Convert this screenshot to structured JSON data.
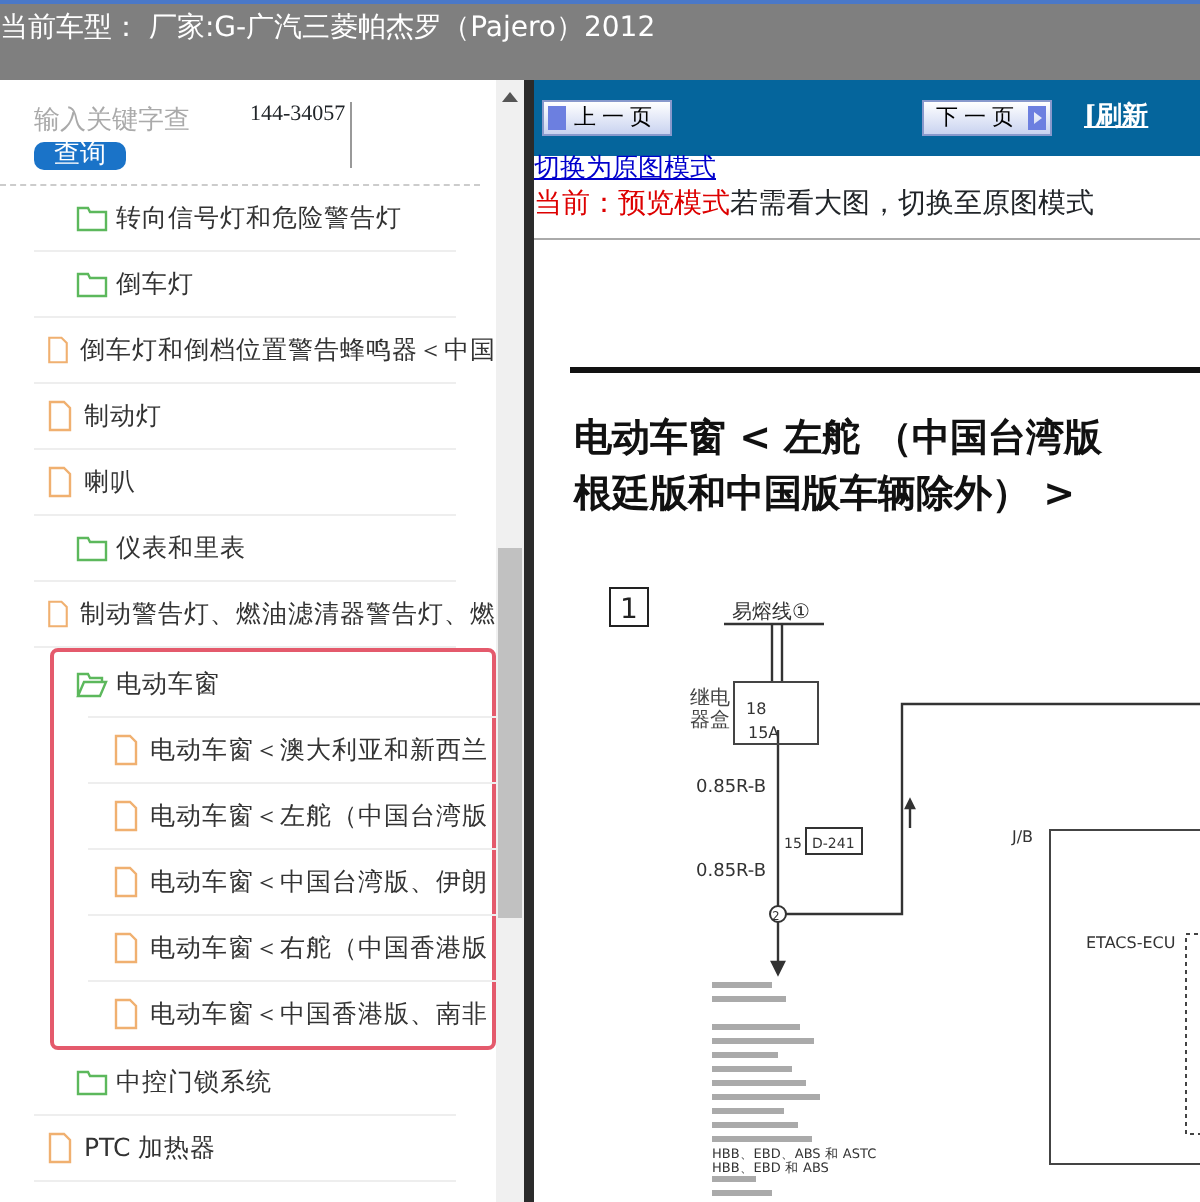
{
  "header": {
    "title": "当前车型：  厂家:G-广汽三菱帕杰罗（Pajero）2012"
  },
  "search": {
    "placeholder": "输入关键字查",
    "button": "查询",
    "code": "144-34057"
  },
  "tree": [
    {
      "kind": "folder",
      "label": "转向信号灯和危险警告灯",
      "expanded": false,
      "selected": false
    },
    {
      "kind": "folder",
      "label": "倒车灯",
      "expanded": false,
      "selected": false
    },
    {
      "kind": "file",
      "label": "倒车灯和倒档位置警告蜂鸣器＜中国",
      "selected": false
    },
    {
      "kind": "file",
      "label": "制动灯",
      "selected": false
    },
    {
      "kind": "file",
      "label": "喇叭",
      "selected": false
    },
    {
      "kind": "folder",
      "label": "仪表和里表",
      "expanded": false,
      "selected": false
    },
    {
      "kind": "file",
      "label": "制动警告灯、燃油滤清器警告灯、燃",
      "selected": false
    },
    {
      "kind": "folder",
      "label": "电动车窗",
      "expanded": true,
      "selected": true,
      "children": [
        {
          "kind": "file",
          "label": "电动车窗＜澳大利亚和新西兰"
        },
        {
          "kind": "file",
          "label": "电动车窗＜左舵（中国台湾版"
        },
        {
          "kind": "file",
          "label": "电动车窗＜中国台湾版、伊朗"
        },
        {
          "kind": "file",
          "label": "电动车窗＜右舵（中国香港版"
        },
        {
          "kind": "file",
          "label": "电动车窗＜中国香港版、南非"
        }
      ]
    },
    {
      "kind": "folder",
      "label": "中控门锁系统",
      "expanded": false,
      "selected": false
    },
    {
      "kind": "file",
      "label": "PTC 加热器",
      "selected": false
    }
  ],
  "viewer": {
    "prev_button": "上一页",
    "next_button": "下一页",
    "refresh_link": "[刷新",
    "mode_link": "切换为原图模式",
    "mode_status": "当前：预览模式",
    "mode_hint": "若需看大图，切换至原图模式",
    "document": {
      "title_lines": [
        "电动车窗 < 左舵 （中国台湾版",
        "根廷版和中国版车辆除外） >"
      ],
      "section": "1",
      "fusible_link": "易熔线①",
      "relay_box": [
        "继电",
        "器盒"
      ],
      "fuse_number": "18",
      "fuse_rating": "15A",
      "wire_labels": [
        "0.85R-B",
        "0.85R-B"
      ],
      "connector_pin": "15",
      "connector": "D-241",
      "junction": "2",
      "jb": "J/B",
      "ecu": "ETACS-ECU",
      "system_lines": [
        "HBB、EBD、ABS 和 ASTC",
        "HBB、EBD 和 ABS"
      ]
    }
  }
}
